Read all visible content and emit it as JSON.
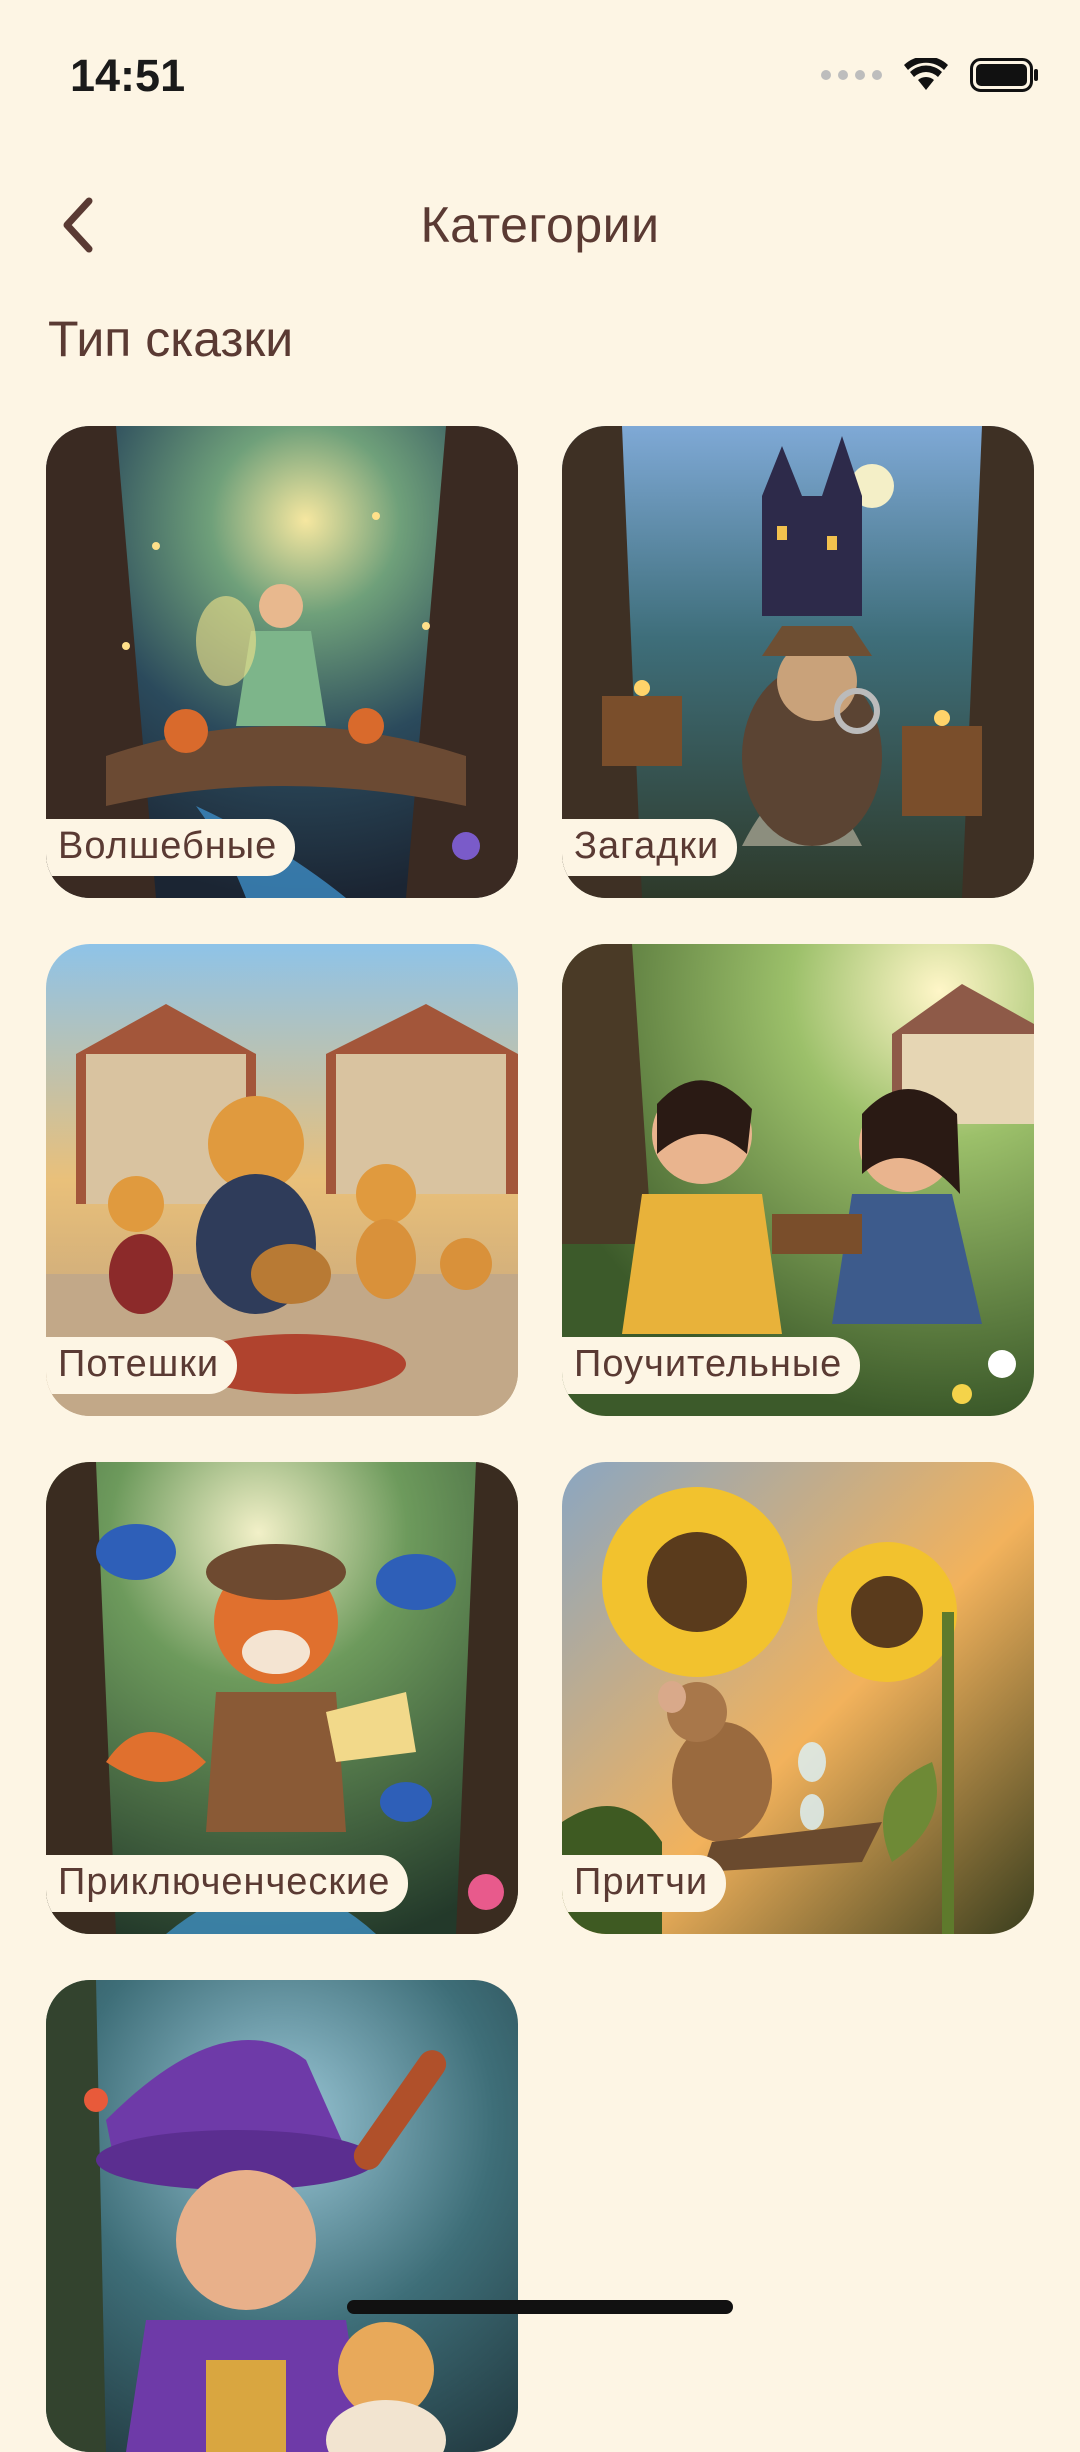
{
  "status_bar": {
    "time": "14:51"
  },
  "header": {
    "title": "Категории"
  },
  "section": {
    "title": "Тип сказки"
  },
  "categories": [
    {
      "label": "Волшебные"
    },
    {
      "label": "Загадки"
    },
    {
      "label": "Потешки"
    },
    {
      "label": "Поучительные"
    },
    {
      "label": "Приключенческие"
    },
    {
      "label": "Притчи"
    },
    {
      "label": ""
    }
  ],
  "colors": {
    "background": "#FDF5E4",
    "text": "#5A3A33",
    "label_background": "#FDF5E4"
  }
}
